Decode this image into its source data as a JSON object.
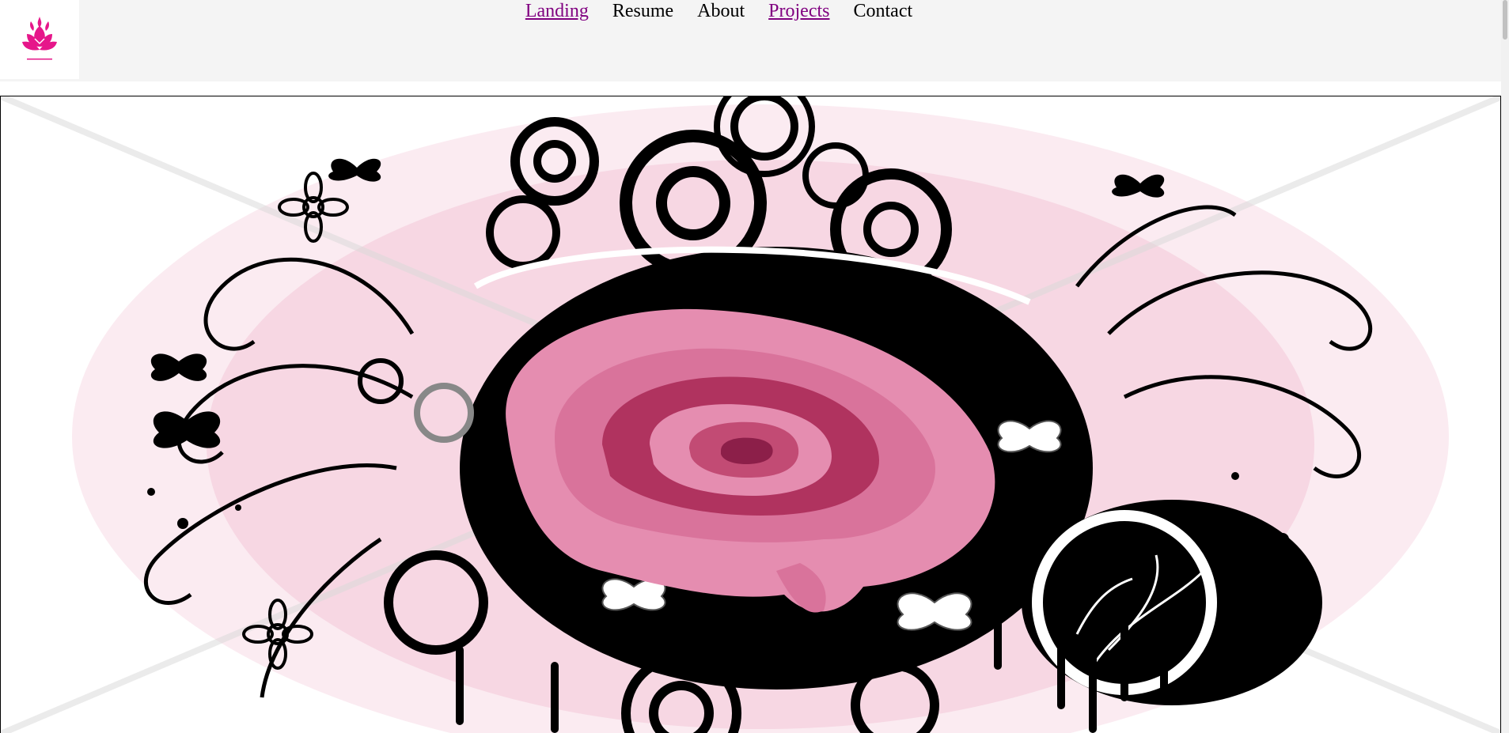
{
  "nav": {
    "items": [
      {
        "label": "Landing",
        "visited": true
      },
      {
        "label": "Resume",
        "visited": false
      },
      {
        "label": "About",
        "visited": false
      },
      {
        "label": "Projects",
        "visited": true
      },
      {
        "label": "Contact",
        "visited": false
      }
    ]
  },
  "logo": {
    "icon": "pink-lotus-flame-icon",
    "color": "#e6168a"
  },
  "hero": {
    "description_icon": "pink-rose-grunge-artwork"
  },
  "colors": {
    "header_bg": "#f4f4f4",
    "visited_link": "#800080",
    "rose_pink": "#e58db0",
    "rose_dark": "#b0335f",
    "swirl_black": "#000000"
  }
}
